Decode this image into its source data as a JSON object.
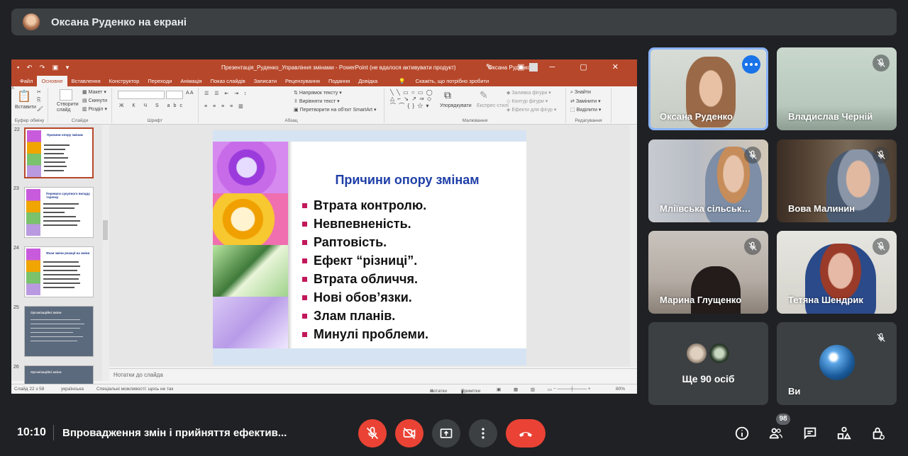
{
  "presenter_banner": {
    "text": "Оксана Руденко на екрані"
  },
  "powerpoint": {
    "window_title": "Презентація_Руденко_Управління змінами  -  PowerPoint (не вдалося активувати продукт)",
    "user_name": "Оксана Руденко",
    "tabs": [
      "Файл",
      "Основне",
      "Вставлення",
      "Конструктор",
      "Переходи",
      "Анімація",
      "Показ слайдів",
      "Записати",
      "Рецензування",
      "Подання",
      "Довідка"
    ],
    "active_tab": "Основне",
    "tell_me": "Скажіть, що потрібно зробити",
    "ribbon": {
      "clipboard_label": "Буфер обміну",
      "paste": "Вставити",
      "slides_label": "Слайди",
      "new_slide": "Створити слайд",
      "layout": "Макет",
      "reset": "Скинути",
      "section": "Розділ",
      "font_label": "Шрифт",
      "paragraph_label": "Абзац",
      "text_direction": "Напрямок тексту",
      "align_text": "Вирівняти текст",
      "smartart": "Перетворити на об'єкт SmartArt",
      "drawing_label": "Малювання",
      "arrange": "Упорядкувати",
      "quick_styles": "Експрес-стилі",
      "shape_fill": "Заливка фігури",
      "shape_outline": "Контур фігури",
      "shape_effects": "Ефекти для фігур",
      "editing_label": "Редагування",
      "find": "Знайти",
      "replace": "Замінити",
      "select": "Виділити"
    },
    "thumbnails": [
      {
        "num": "22",
        "title": "Причини опору змінам",
        "selected": true
      },
      {
        "num": "23",
        "title": "Переваги сукупного вкладу терпеку"
      },
      {
        "num": "24",
        "title": "Фази зміни реакції на зміни"
      },
      {
        "num": "25",
        "title": "Організаційні зміни"
      },
      {
        "num": "26",
        "title": "Організаційні зміни"
      }
    ],
    "slide": {
      "title": "Причини опору змінам",
      "bullets": [
        "Втрата контролю.",
        "Невпевненість.",
        "Раптовість.",
        "Ефект “різниці”.",
        "Втрата обличчя.",
        "Нові обов’язки.",
        "Злам планів.",
        "Минулі проблеми."
      ]
    },
    "notes_placeholder": "Нотатки до слайда",
    "status": {
      "slide_counter": "Слайд 22 з 58",
      "language": "українська",
      "accessibility": "Спеціальні можливості: щось не так",
      "notes": "Нотатки",
      "comments": "Примітки",
      "zoom": "80%"
    }
  },
  "participants": [
    {
      "name": "Оксана Руденко",
      "speaking": true
    },
    {
      "name": "Владислав Черній",
      "muted": true
    },
    {
      "name": "Мліївська сільськ…",
      "muted": true
    },
    {
      "name": "Вова Малинин",
      "muted": true
    },
    {
      "name": "Марина Глущенко",
      "muted": true
    },
    {
      "name": "Тетяна Шендрик",
      "muted": true
    },
    {
      "name": "Ще 90 осіб"
    },
    {
      "name": "Ви",
      "muted": true
    }
  ],
  "bottom_bar": {
    "time": "10:10",
    "meeting_title": "Впровадження змін і прийняття ефектив...",
    "participant_count": "98"
  },
  "colors": {
    "meet_bg": "#202124",
    "tile_bg": "#3c4043",
    "red": "#ea4335",
    "accent_blue": "#1a73e8",
    "ppt_orange": "#b7472a",
    "slide_title": "#1f3fa8",
    "bullet_mark": "#c2185b"
  }
}
